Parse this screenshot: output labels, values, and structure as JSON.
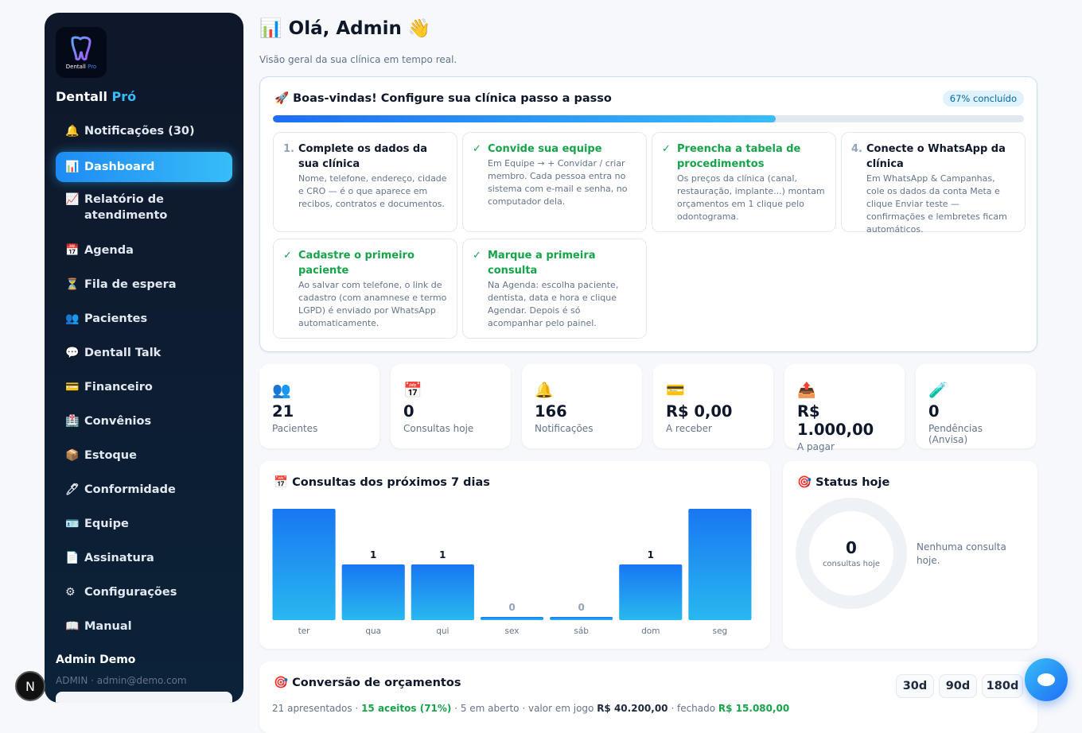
{
  "sidebar": {
    "logo_text_a": "Dentall",
    "logo_text_b": "Pro",
    "brand_a": "Dentall",
    "brand_b": "Pró",
    "items": [
      {
        "icon": "bell-icon",
        "glyph": "🔔",
        "label": "Notificações (30)"
      },
      {
        "icon": "chart-icon",
        "glyph": "📊",
        "label": "Dashboard",
        "active": true
      },
      {
        "icon": "trend-icon",
        "glyph": "📈",
        "label": "Relatório de atendimento"
      },
      {
        "icon": "calendar-icon",
        "glyph": "📅",
        "label": "Agenda"
      },
      {
        "icon": "hourglass-icon",
        "glyph": "⏳",
        "label": "Fila de espera"
      },
      {
        "icon": "people-icon",
        "glyph": "👥",
        "label": "Pacientes"
      },
      {
        "icon": "talk-icon",
        "glyph": "💬",
        "label": "Dentall Talk"
      },
      {
        "icon": "card-icon",
        "glyph": "💳",
        "label": "Financeiro"
      },
      {
        "icon": "insurance-icon",
        "glyph": "🏥",
        "label": "Convênios"
      },
      {
        "icon": "box-icon",
        "glyph": "📦",
        "label": "Estoque"
      },
      {
        "icon": "pen-icon",
        "glyph": "🖊",
        "label": "Conformidade"
      },
      {
        "icon": "id-card-icon",
        "glyph": "🪪",
        "label": "Equipe"
      },
      {
        "icon": "document-icon",
        "glyph": "📄",
        "label": "Assinatura"
      },
      {
        "icon": "gear-icon",
        "glyph": "⚙",
        "label": "Configurações"
      },
      {
        "icon": "book-icon",
        "glyph": "📖",
        "label": "Manual"
      }
    ],
    "user_name": "Admin Demo",
    "user_mail": "ADMIN · admin@demo.com"
  },
  "badge": "N",
  "header": {
    "icon": "📊",
    "title": "Olá, Admin 👋",
    "subtitle": "Visão geral da sua clínica em tempo real."
  },
  "setup": {
    "icon": "🚀",
    "title": "Boas-vindas! Configure sua clínica passo a passo",
    "progress_label": "67% concluído",
    "progress": 0.67,
    "steps": [
      {
        "marker": "1.",
        "done": false,
        "title": "Complete os dados da sua clínica",
        "desc": "Nome, telefone, endereço, cidade e CRO — é o que aparece em recibos, contratos e documentos."
      },
      {
        "marker": "✓",
        "done": true,
        "title": "Convide sua equipe",
        "desc": "Em Equipe → + Convidar / criar membro. Cada pessoa entra no sistema com e-mail e senha, no computador dela."
      },
      {
        "marker": "✓",
        "done": true,
        "title": "Preencha a tabela de procedimentos",
        "desc": "Os preços da clínica (canal, restauração, implante...) montam orçamentos em 1 clique pelo odontograma."
      },
      {
        "marker": "4.",
        "done": false,
        "title": "Conecte o WhatsApp da clínica",
        "desc": "Em WhatsApp & Campanhas, cole os dados da conta Meta e clique Enviar teste — confirmações e lembretes ficam automáticos."
      },
      {
        "marker": "✓",
        "done": true,
        "title": "Cadastre o primeiro paciente",
        "desc": "Ao salvar com telefone, o link de cadastro (com anamnese e termo LGPD) é enviado por WhatsApp automaticamente."
      },
      {
        "marker": "✓",
        "done": true,
        "title": "Marque a primeira consulta",
        "desc": "Na Agenda: escolha paciente, dentista, data e hora e clique Agendar. Depois é só acompanhar pelo painel."
      }
    ]
  },
  "stats": [
    {
      "icon": "people-icon",
      "glyph": "👥",
      "value": "21",
      "label": "Pacientes"
    },
    {
      "icon": "calendar-icon",
      "glyph": "📅",
      "value": "0",
      "label": "Consultas hoje"
    },
    {
      "icon": "bell-icon",
      "glyph": "🔔",
      "value": "166",
      "label": "Notificações"
    },
    {
      "icon": "card-icon",
      "glyph": "💳",
      "value": "R$ 0,00",
      "label": "A receber"
    },
    {
      "icon": "outbox-icon",
      "glyph": "📤",
      "value": "R$ 1.000,00",
      "label": "A pagar"
    },
    {
      "icon": "test-tube-icon",
      "glyph": "🧪",
      "value": "0",
      "label": "Pendências (Anvisa)"
    }
  ],
  "chart_card": {
    "icon": "📅",
    "title": "Consultas dos próximos 7 dias"
  },
  "chart_data": {
    "type": "bar",
    "categories": [
      "ter",
      "qua",
      "qui",
      "sex",
      "sáb",
      "dom",
      "seg"
    ],
    "values": [
      2,
      1,
      1,
      0,
      0,
      1,
      2
    ],
    "ylim": [
      0,
      2
    ],
    "grid": false,
    "colors": {
      "top": "#1877f2",
      "bottom": "#28b8f0"
    }
  },
  "status": {
    "icon": "🎯",
    "title": "Status hoje",
    "value": "0",
    "value_label": "consultas hoje",
    "note": "Nenhuma consulta hoje."
  },
  "conversion": {
    "icon": "🎯",
    "title": "Conversão de orçamentos",
    "ranges": [
      "30d",
      "90d",
      "180d"
    ],
    "presented": "21 apresentados · ",
    "accepted": "15 aceitos (71%)",
    "mid": " · 5 em aberto · valor em jogo ",
    "value_at_stake": "R$ 40.200,00",
    "closed_label": " · fechado ",
    "closed": "R$ 15.080,00"
  }
}
